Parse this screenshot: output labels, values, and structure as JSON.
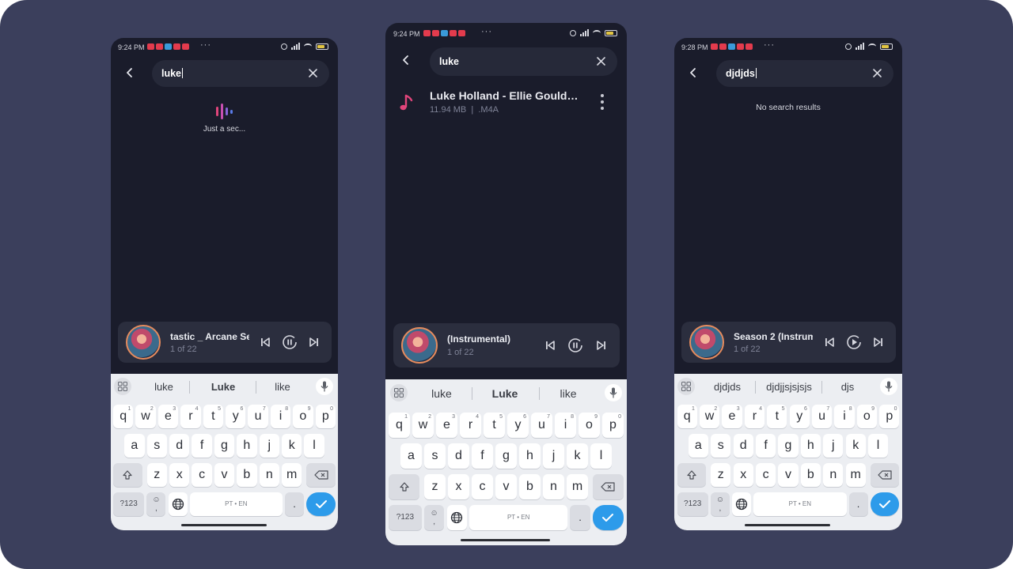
{
  "screens": [
    {
      "status": {
        "time": "9:24 PM",
        "dots": "···"
      },
      "search": {
        "query": "luke"
      },
      "loading": {
        "text": "Just a sec..."
      },
      "player": {
        "title": "tastic _ Arcane Se",
        "position": "1 of 22"
      },
      "keyboard": {
        "suggestions": [
          "luke",
          "Luke",
          "like"
        ],
        "space_label": "PT • EN",
        "symbols_label": "?123",
        "period": ".",
        "emoji_top": "☺",
        "emoji_bottom": ","
      }
    },
    {
      "status": {
        "time": "9:24 PM",
        "dots": "···"
      },
      "search": {
        "query": "luke"
      },
      "result": {
        "title": "Luke Holland - Ellie Goulding",
        "meta": "11.94 MB  |  .M4A"
      },
      "player": {
        "title": "(Instrumental)",
        "position": "1 of 22"
      },
      "keyboard": {
        "suggestions": [
          "luke",
          "Luke",
          "like"
        ],
        "space_label": "PT • EN",
        "symbols_label": "?123",
        "period": ".",
        "emoji_top": "☺",
        "emoji_bottom": ","
      }
    },
    {
      "status": {
        "time": "9:28 PM",
        "dots": "···"
      },
      "search": {
        "query": "djdjds"
      },
      "empty": {
        "text": "No search results"
      },
      "player": {
        "title": "Season 2 (Instrume",
        "position": "1 of 22"
      },
      "keyboard": {
        "suggestions": [
          "djdjds",
          "djdjjsjsjsjs",
          "djs"
        ],
        "space_label": "PT • EN",
        "symbols_label": "?123",
        "period": ".",
        "emoji_top": "☺",
        "emoji_bottom": ","
      }
    }
  ],
  "keyboard_rows": {
    "row1": [
      "q",
      "w",
      "e",
      "r",
      "t",
      "y",
      "u",
      "i",
      "o",
      "p"
    ],
    "row1_numbers": [
      "1",
      "2",
      "3",
      "4",
      "5",
      "6",
      "7",
      "8",
      "9",
      "0"
    ],
    "row2": [
      "a",
      "s",
      "d",
      "f",
      "g",
      "h",
      "j",
      "k",
      "l"
    ],
    "row3": [
      "z",
      "x",
      "c",
      "v",
      "b",
      "n",
      "m"
    ]
  },
  "colors": {
    "background": "#3b3f5c",
    "app_background": "#1a1c2b",
    "search_field": "#262939",
    "player_bar": "#2b2e3e",
    "accent_pink": "#e0457b",
    "keyboard": "#eceef2",
    "enter_key": "#2d9bea"
  },
  "icons": [
    "back-arrow-icon",
    "clear-icon",
    "music-note-icon",
    "more-vert-icon",
    "skip-previous-icon",
    "pause-icon",
    "play-icon",
    "skip-next-icon",
    "grid-icon",
    "mic-icon",
    "shift-icon",
    "backspace-icon",
    "globe-icon",
    "check-icon"
  ]
}
